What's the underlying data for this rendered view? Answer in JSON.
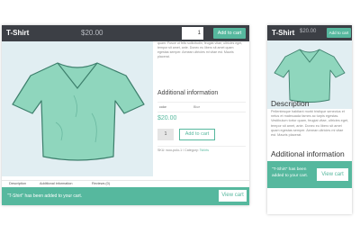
{
  "desktop": {
    "product_title": "T-Shirt",
    "price": "$20.00",
    "quantity": "1",
    "add_to_cart": "Add to cart",
    "summary_text": "quam. Fusce ut felis sollicitudin, feugiat vitae, ultricies eget, tempor sit amet, ante. Donec eu libero sit amet quam egestas semper. Aenean ultricies mi vitae est. Mauris placerat.",
    "additional_information_heading": "Additional information",
    "attribute_label": "color",
    "attribute_value": "Blue",
    "content_price": "$20.00",
    "content_quantity": "1",
    "content_add_to_cart": "Add to cart",
    "meta_sku": "SKU: woo-polo-1 / Category:",
    "meta_category": "Tshirts",
    "tabs": [
      "Description",
      "Additional information",
      "Reviews (0)"
    ],
    "notice": "“T-Shirt” has been added to your cart.",
    "view_cart": "View cart"
  },
  "mobile": {
    "product_title": "T-Shirt",
    "price": "$20.00",
    "add_to_cart": "Add to cart",
    "description_heading": "Description",
    "description_text": "Pellentesque habitant morbi tristique senectus et netus et malesuada fames ac turpis egestas. Vestibulum tortor quam, feugiat vitae, ultricies eget, tempor sit amet, ante. Donec eu libero sit amet quam egestas semper. Aenean ultricies mi vitae est. Mauris placerat.",
    "additional_information_heading": "Additional information",
    "notice": "“T-Shirt” has been added to your cart.",
    "view_cart": "View cart"
  },
  "colors": {
    "accent": "#56b89e",
    "bar": "#3c3f45",
    "photo_background": "#e1eef2",
    "shirt": "#8fd6bd"
  }
}
